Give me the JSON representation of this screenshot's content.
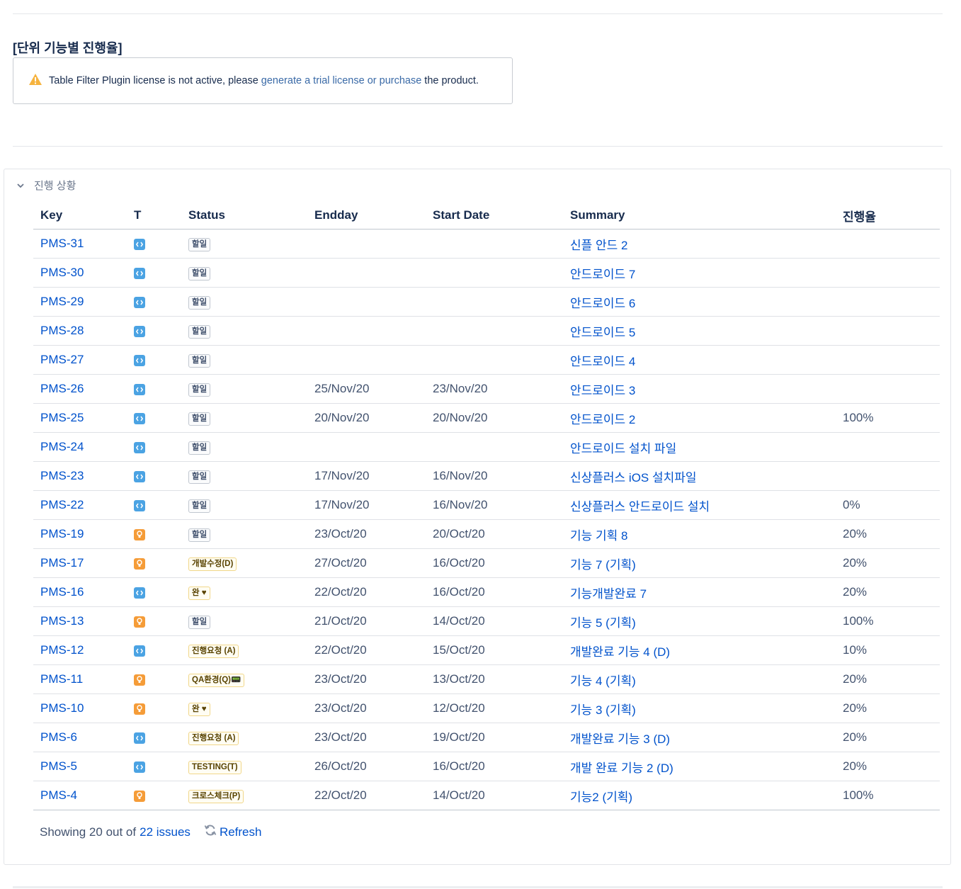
{
  "page": {
    "heading": "[단위 기능별 진행율]"
  },
  "notice": {
    "text_before": "Table Filter Plugin license is not active, please",
    "link": "generate a trial license or purchase",
    "text_after": "the product.",
    "icon": "warning-icon",
    "icon_color": "#f6b33e"
  },
  "panel": {
    "title": "진행 상황",
    "columns": [
      "Key",
      "T",
      "Status",
      "Endday",
      "Start Date",
      "Summary",
      "진행율"
    ],
    "rows": [
      {
        "key": "PMS-31",
        "type": "task",
        "status": "할일",
        "status_style": "gray",
        "endday": "",
        "start": "",
        "summary": "신플 안드 2",
        "progress": ""
      },
      {
        "key": "PMS-30",
        "type": "task",
        "status": "할일",
        "status_style": "gray",
        "endday": "",
        "start": "",
        "summary": "안드로이드 7",
        "progress": ""
      },
      {
        "key": "PMS-29",
        "type": "task",
        "status": "할일",
        "status_style": "gray",
        "endday": "",
        "start": "",
        "summary": "안드로이드 6",
        "progress": ""
      },
      {
        "key": "PMS-28",
        "type": "task",
        "status": "할일",
        "status_style": "gray",
        "endday": "",
        "start": "",
        "summary": "안드로이드 5",
        "progress": ""
      },
      {
        "key": "PMS-27",
        "type": "task",
        "status": "할일",
        "status_style": "gray",
        "endday": "",
        "start": "",
        "summary": "안드로이드 4",
        "progress": ""
      },
      {
        "key": "PMS-26",
        "type": "task",
        "status": "할일",
        "status_style": "gray",
        "endday": "25/Nov/20",
        "start": "23/Nov/20",
        "summary": "안드로이드 3",
        "progress": ""
      },
      {
        "key": "PMS-25",
        "type": "task",
        "status": "할일",
        "status_style": "gray",
        "endday": "20/Nov/20",
        "start": "20/Nov/20",
        "summary": "안드로이드 2",
        "progress": "100%"
      },
      {
        "key": "PMS-24",
        "type": "task",
        "status": "할일",
        "status_style": "gray",
        "endday": "",
        "start": "",
        "summary": "안드로이드 설치 파일",
        "progress": ""
      },
      {
        "key": "PMS-23",
        "type": "task",
        "status": "할일",
        "status_style": "gray",
        "endday": "17/Nov/20",
        "start": "16/Nov/20",
        "summary": "신상플러스 iOS 설치파일",
        "progress": ""
      },
      {
        "key": "PMS-22",
        "type": "task",
        "status": "할일",
        "status_style": "gray",
        "endday": "17/Nov/20",
        "start": "16/Nov/20",
        "summary": "신상플러스 안드로이드 설치",
        "progress": "0%"
      },
      {
        "key": "PMS-19",
        "type": "story",
        "status": "할일",
        "status_style": "gray",
        "endday": "23/Oct/20",
        "start": "20/Oct/20",
        "summary": "기능 기획 8",
        "progress": "20%"
      },
      {
        "key": "PMS-17",
        "type": "story",
        "status": "개발수정(D)",
        "status_style": "yellow",
        "endday": "27/Oct/20",
        "start": "16/Oct/20",
        "summary": "기능 7 (기획)",
        "progress": "20%"
      },
      {
        "key": "PMS-16",
        "type": "task",
        "status": "완 ♥",
        "status_style": "yellow",
        "endday": "22/Oct/20",
        "start": "16/Oct/20",
        "summary": "기능개발완료 7",
        "progress": "20%"
      },
      {
        "key": "PMS-13",
        "type": "story",
        "status": "할일",
        "status_style": "gray",
        "endday": "21/Oct/20",
        "start": "14/Oct/20",
        "summary": "기능 5 (기획)",
        "progress": "100%"
      },
      {
        "key": "PMS-12",
        "type": "task",
        "status": "진행요청 (A)",
        "status_style": "yellow",
        "endday": "22/Oct/20",
        "start": "15/Oct/20",
        "summary": "개발완료 기능 4 (D)",
        "progress": "10%"
      },
      {
        "key": "PMS-11",
        "type": "story",
        "status": "QA환경(Q)📟",
        "status_style": "yellow",
        "endday": "23/Oct/20",
        "start": "13/Oct/20",
        "summary": "기능 4 (기획)",
        "progress": "20%"
      },
      {
        "key": "PMS-10",
        "type": "story",
        "status": "완 ♥",
        "status_style": "yellow",
        "endday": "23/Oct/20",
        "start": "12/Oct/20",
        "summary": "기능 3 (기획)",
        "progress": "20%"
      },
      {
        "key": "PMS-6",
        "type": "task",
        "status": "진행요청 (A)",
        "status_style": "yellow",
        "endday": "23/Oct/20",
        "start": "19/Oct/20",
        "summary": "개발완료 기능 3 (D)",
        "progress": "20%"
      },
      {
        "key": "PMS-5",
        "type": "task",
        "status": "TESTING(T)",
        "status_style": "yellow",
        "endday": "26/Oct/20",
        "start": "16/Oct/20",
        "summary": "개발 완료 기능 2 (D)",
        "progress": "20%"
      },
      {
        "key": "PMS-4",
        "type": "story",
        "status": "크로스체크(P)",
        "status_style": "yellow",
        "endday": "22/Oct/20",
        "start": "14/Oct/20",
        "summary": "기능2 (기획)",
        "progress": "100%"
      }
    ],
    "footer": {
      "showing": "Showing 20 out of",
      "count_link": "22 issues",
      "refresh": "Refresh"
    }
  },
  "colors": {
    "link": "#0052cc",
    "task_icon": "#4ba3e3",
    "story_icon": "#f59c38"
  }
}
